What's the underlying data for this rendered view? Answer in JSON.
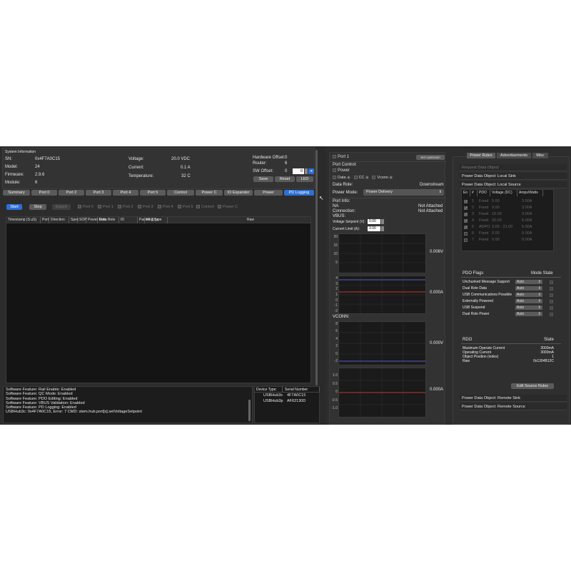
{
  "system": {
    "title": "System Information",
    "sn_label": "SN:",
    "sn": "0x4F7A0C15",
    "model_label": "Model:",
    "model": "24",
    "firmware_label": "Firmware:",
    "firmware": "2.9.6",
    "module_label": "Module:",
    "module": "6",
    "voltage_label": "Voltage:",
    "voltage": "20.0 VDC",
    "current_label": "Current:",
    "current": "0.1 A",
    "temperature_label": "Temperature:",
    "temperature": "32 C",
    "hw_offset_label": "Hardware Offset:",
    "hw_offset": "0",
    "router_label": "Router:",
    "router": "6",
    "sw_offset_label": "SW Offset:",
    "sw_offset": "0",
    "sw_offset_field": "0",
    "save_label": "Save",
    "reset_label": "Reset",
    "led_label": "LED"
  },
  "tabs": [
    "Summary",
    "Port 0",
    "Port 2",
    "Port 3",
    "Port 4",
    "Port 5",
    "Control",
    "Power C",
    "IO Expander",
    "Power",
    "PD Logging"
  ],
  "active_tab": "PD Logging",
  "logging": {
    "start_label": "Start",
    "stop_label": "Stop",
    "export_label": "Export",
    "filters": [
      "Port 0",
      "Port 1",
      "Port 2",
      "Port 3",
      "Port 4",
      "Port 5",
      "Control",
      "Power C"
    ],
    "columns": [
      "Timestamp (S.uS)",
      "Port",
      "Direction",
      "Spec",
      "SOP",
      "Power Role",
      "Data Role",
      "ID",
      "Packet Type",
      "Msg Type",
      "Raw"
    ]
  },
  "console": [
    "Software Feature: Rail Enable: Enabled",
    "Software Feature: QC Mode: Enabled",
    "Software Feature: PDO Editing: Enabled",
    "Software Feature: VBUS Validation: Enabled",
    "Software Feature: PD Logging: Enabled",
    "USBHub3c: 0x4F7A0C15, Error: 7 CMD: stem.hub.port[x].setVoltageSetpoint"
  ],
  "devices": {
    "col_type": "Device Type:",
    "col_serial": "Serial Number:",
    "rows": [
      {
        "type": "USBHub3c",
        "serial": "4F7A0C15"
      },
      {
        "type": "USBHub3p",
        "serial": "AF62130D"
      }
    ]
  },
  "port": {
    "title": "Port 1",
    "set_upstream_label": "Set Upstream",
    "port_control_label": "Port Control:",
    "power_label": "Power",
    "data_label": "Data",
    "cc_label": "CC",
    "vconn_label": "Vconn",
    "data_role_label": "Data Role:",
    "data_role": "Downstream",
    "power_mode_label": "Power Mode:",
    "power_mode": "Power Delivery",
    "port_info_label": "Port Info:",
    "na_label": "NA",
    "na_value": "Not Attached",
    "connection_label": "Connection:",
    "connection_value": "Not Attached",
    "vbus_label": "VBUS:",
    "voltage_setpoint_label": "Voltage Setpoint (V):",
    "voltage_setpoint": "0.00",
    "current_limit_label": "Current Limit (A):",
    "current_limit": "3.00",
    "vbus_voltage_reading": "0.006V",
    "vbus_current_reading": "0.000A",
    "vconn_label2": "VCONN:",
    "vconn_voltage_reading": "0.000V",
    "vconn_current_reading": "0.000A",
    "vbus_v_ticks": [
      "20",
      "15",
      "10",
      "5"
    ],
    "vbus_i_ticks": [
      "4",
      "3",
      "2",
      "1",
      "0",
      "-1",
      "-2"
    ],
    "vconn_v_ticks": [
      "8",
      "6",
      "4",
      "2",
      "0",
      "-2"
    ],
    "vconn_i_ticks": [
      "1.0",
      "0.5",
      "0",
      "-0.5",
      "-1.0"
    ]
  },
  "right": {
    "tabs": [
      "Power Rules",
      "Advertisements",
      "Misc"
    ],
    "sections": [
      "Request Data Object",
      "Power Data Object: Local Sink",
      "Power Data Object: Local Source"
    ],
    "pdo_columns": [
      "En",
      "#",
      "PDO",
      "Voltage (DC)",
      "Amps/Watts"
    ],
    "pdo_rows": [
      {
        "en": true,
        "n": "1",
        "pdo": "Fixed",
        "v": "5.00",
        "a": "3.00A",
        "dim": true
      },
      {
        "en": true,
        "n": "2",
        "pdo": "Fixed",
        "v": "9.00",
        "a": "3.00A",
        "dim": true
      },
      {
        "en": true,
        "n": "3",
        "pdo": "Fixed",
        "v": "15.00",
        "a": "3.00A",
        "dim": true
      },
      {
        "en": true,
        "n": "4",
        "pdo": "Fixed",
        "v": "20.00",
        "a": "5.00A",
        "dim": true
      },
      {
        "en": true,
        "n": "5",
        "pdo": "ADPO",
        "v": "3.00 - 21.00",
        "a": "5.00A",
        "dim": true
      },
      {
        "en": false,
        "n": "6",
        "pdo": "Fixed",
        "v": "0.00",
        "a": "0.00A",
        "dim": true
      },
      {
        "en": false,
        "n": "7",
        "pdo": "Fixed",
        "v": "0.00",
        "a": "0.00A",
        "dim": true
      }
    ],
    "flags_title": "PDO Flags",
    "mode_state_label": "Mode State",
    "flags": [
      {
        "name": "Unchunked Message Support",
        "mode": "Auto"
      },
      {
        "name": "Dual Role Data",
        "mode": "Auto"
      },
      {
        "name": "USB Communications Possible",
        "mode": "Auto"
      },
      {
        "name": "Externally Powered",
        "mode": "Auto"
      },
      {
        "name": "USB Suspend",
        "mode": "Auto"
      },
      {
        "name": "Dual Role Power",
        "mode": "Auto"
      }
    ],
    "rdo_label": "RDO",
    "state_label": "State",
    "rdo_rows": [
      {
        "k": "Maximum Operate Current",
        "v": "3000mA"
      },
      {
        "k": "Operating Current",
        "v": "3000mA"
      },
      {
        "k": "Object Position (index)",
        "v": "1"
      },
      {
        "k": "Raw",
        "v": "0x1304B12C"
      }
    ],
    "edit_label": "Edit Source Rules",
    "bottom_sections": [
      "Power Data Object: Remote Sink",
      "Power Data Object: Remote Source"
    ]
  },
  "colors": {
    "accent": "#2d6fd6",
    "bg": "#2a2a2a",
    "graph_red": "#c0392b",
    "graph_blue": "#5a5ad0"
  }
}
